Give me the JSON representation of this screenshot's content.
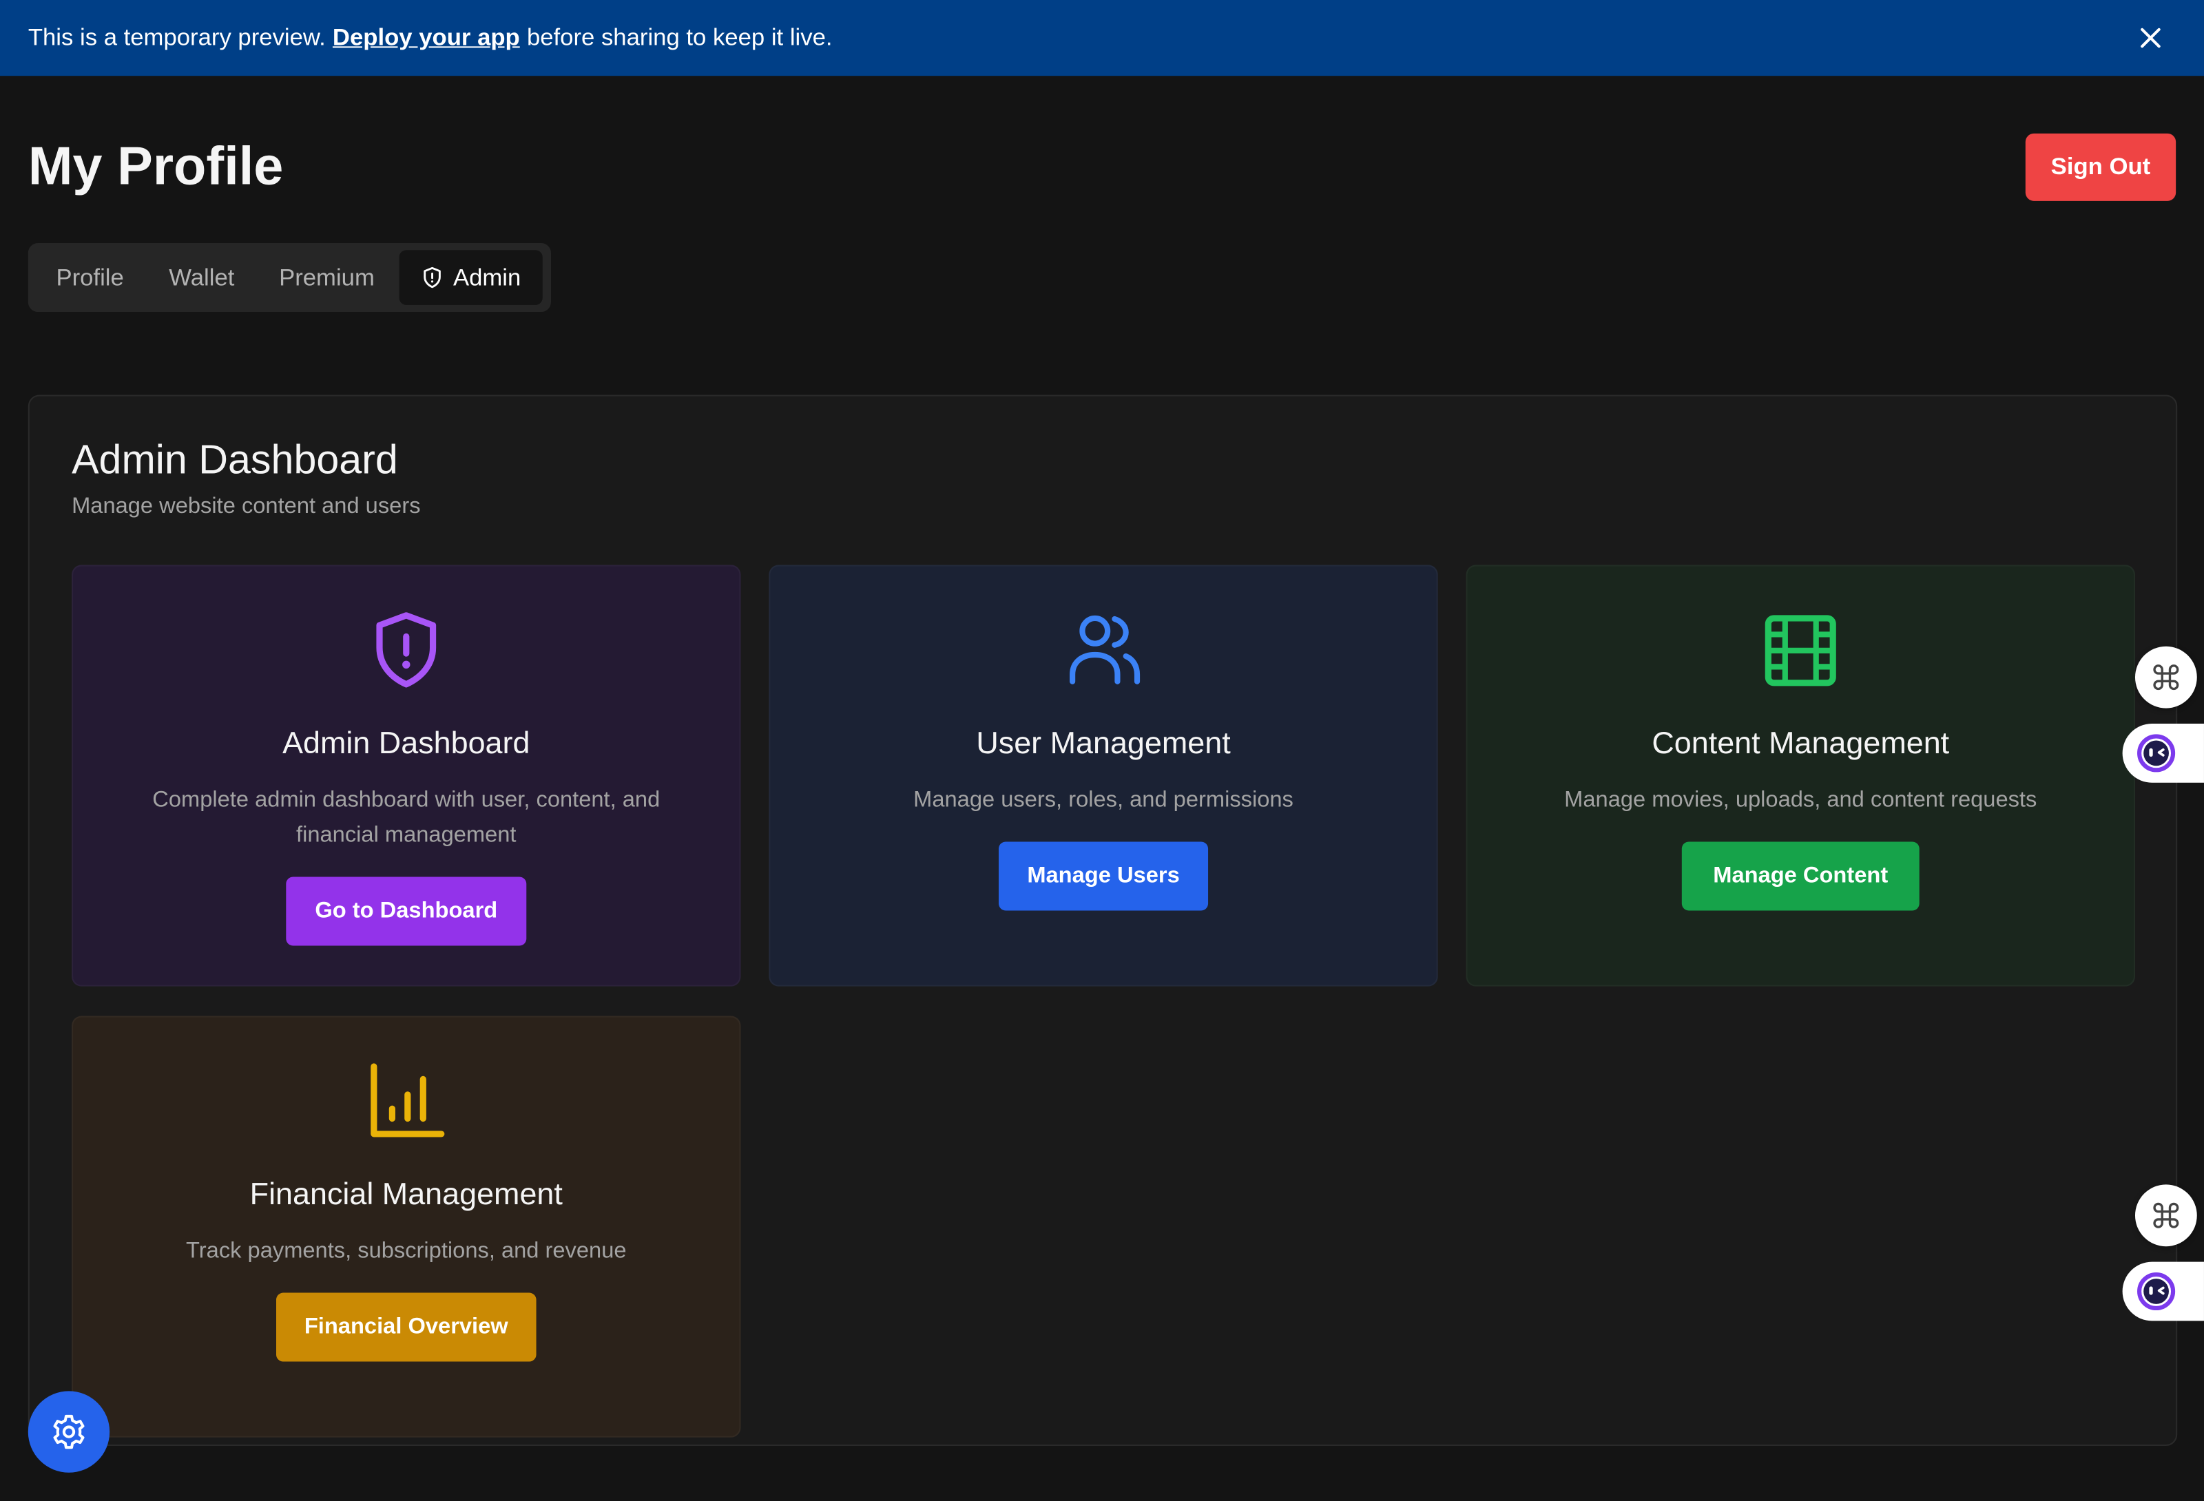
{
  "banner": {
    "text_before": "This is a temporary preview.",
    "link": "Deploy your app",
    "text_after": "before sharing to keep it live."
  },
  "header": {
    "title": "My Profile",
    "sign_out": "Sign Out"
  },
  "tabs": [
    {
      "label": "Profile"
    },
    {
      "label": "Wallet"
    },
    {
      "label": "Premium"
    },
    {
      "label": "Admin",
      "icon": "shield-alert-icon",
      "active": true
    }
  ],
  "panel": {
    "title": "Admin Dashboard",
    "subtitle": "Manage website content and users"
  },
  "cards": [
    {
      "title": "Admin Dashboard",
      "description": "Complete admin dashboard with user, content, and financial management",
      "button": "Go to Dashboard",
      "icon": "shield-alert-icon",
      "color": "#9333ea"
    },
    {
      "title": "User Management",
      "description": "Manage users, roles, and permissions",
      "button": "Manage Users",
      "icon": "users-icon",
      "color": "#2563eb"
    },
    {
      "title": "Content Management",
      "description": "Manage movies, uploads, and content requests",
      "button": "Manage Content",
      "icon": "film-icon",
      "color": "#16a34a"
    },
    {
      "title": "Financial Management",
      "description": "Track payments, subscriptions, and revenue",
      "button": "Financial Overview",
      "icon": "bar-chart-icon",
      "color": "#ca8a04"
    }
  ],
  "colors": {
    "banner": "#003f87",
    "background": "#141414",
    "sign_out": "#ef4444",
    "settings_fab": "#2563eb"
  }
}
